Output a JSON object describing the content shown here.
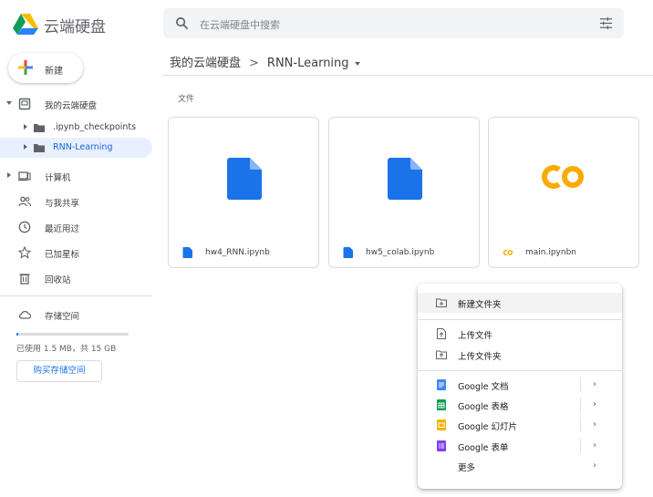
{
  "header": {
    "app_title": "云端硬盘",
    "search_placeholder": "在云端硬盘中搜索"
  },
  "sidebar": {
    "new_label": "新建",
    "my_drive": "我的云端硬盘",
    "folders": [
      ".ipynb_checkpoints",
      "RNN-Learning"
    ],
    "computers": "计算机",
    "shared": "与我共享",
    "recent": "最近用过",
    "starred": "已加星标",
    "trash": "回收站",
    "storage": "存储空间",
    "storage_used_text": "已使用 1.5 MB，共 15 GB",
    "storage_used_fraction": 0.0001,
    "buy_storage": "购买存储空间"
  },
  "main": {
    "breadcrumb_root": "我的云端硬盘",
    "breadcrumb_sep": ">",
    "breadcrumb_current": "RNN-Learning",
    "section_label": "文件",
    "files": [
      {
        "name": "hw4_RNN.ipynb",
        "icon": "doc-icon"
      },
      {
        "name": "hw5_colab.ipynb",
        "icon": "doc-icon"
      },
      {
        "name": "main.ipynbn",
        "icon": "colab-icon"
      }
    ]
  },
  "context_menu": {
    "new_folder": "新建文件夹",
    "upload_file": "上传文件",
    "upload_folder": "上传文件夹",
    "google_docs": "Google 文档",
    "google_sheets": "Google 表格",
    "google_slides": "Google 幻灯片",
    "google_forms": "Google 表单",
    "more": "更多",
    "chevron": "›"
  },
  "colors": {
    "accent": "#1a73e8",
    "active_bg": "#e8f0fe",
    "docs": "#4285f4",
    "sheets": "#0f9d58",
    "slides": "#f4b400",
    "forms": "#7e3ff2",
    "colab": "#f9ab00"
  }
}
